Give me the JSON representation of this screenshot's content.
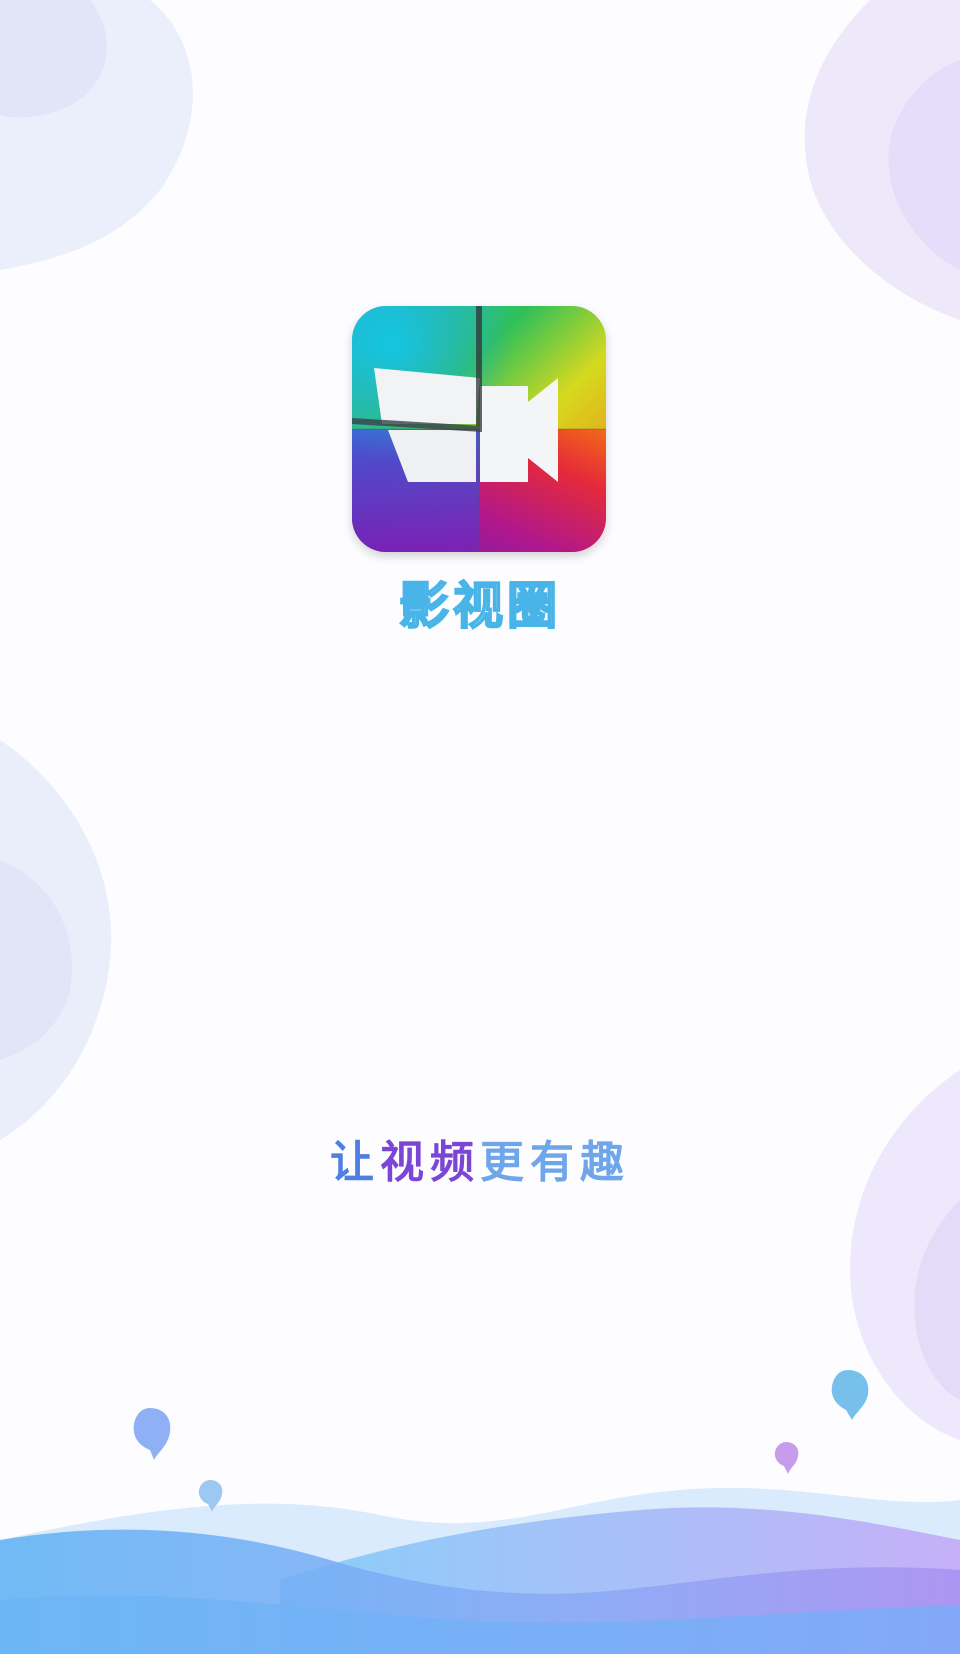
{
  "app": {
    "name": "影视圈",
    "logo_icon": "video-camera-icon"
  },
  "slogan": {
    "part1": "让",
    "part2": "视频",
    "part3": "更有趣"
  },
  "colors": {
    "accent_blue": "#48b4e8",
    "slogan_blue": "#4f7fe0",
    "slogan_purple": "#7b45d6",
    "wave_blue": "#5aa8f2",
    "wave_purple": "#b59cf5"
  }
}
